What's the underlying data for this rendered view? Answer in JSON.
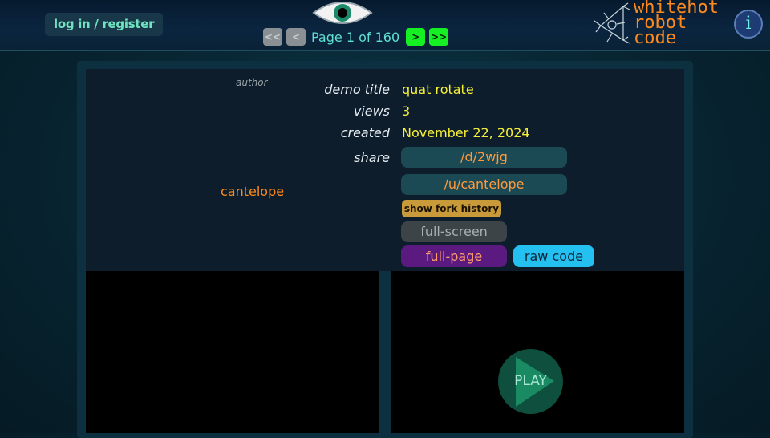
{
  "header": {
    "login_label": "log in / register",
    "pager": {
      "first": "<<",
      "prev": "<",
      "text": "Page 1 of 160",
      "next": ">",
      "last": ">>"
    },
    "logo": {
      "line1": "whitehot",
      "line2": "robot",
      "line3": "code"
    },
    "info_label": "i"
  },
  "demo": {
    "author_label": "author",
    "author_name": "cantelope",
    "title_label": "demo title",
    "title": "quat rotate",
    "views_label": "views",
    "views": "3",
    "created_label": "created",
    "created": "November 22, 2024",
    "share_label": "share",
    "share_links": [
      "/d/2wjg",
      "/u/cantelope"
    ],
    "fork_history_label": "show fork history",
    "fullscreen_label": "full-screen",
    "fullpage_label": "full-page",
    "rawcode_label": "raw code",
    "play_label": "PLAY"
  },
  "colors": {
    "accent_green": "#16ef24",
    "orange": "#ff8a1c",
    "yellow": "#f7f038",
    "teal": "#5fe0d2"
  },
  "icons": [
    "eye-icon",
    "robot-logo-icon",
    "info-icon",
    "play-icon"
  ]
}
